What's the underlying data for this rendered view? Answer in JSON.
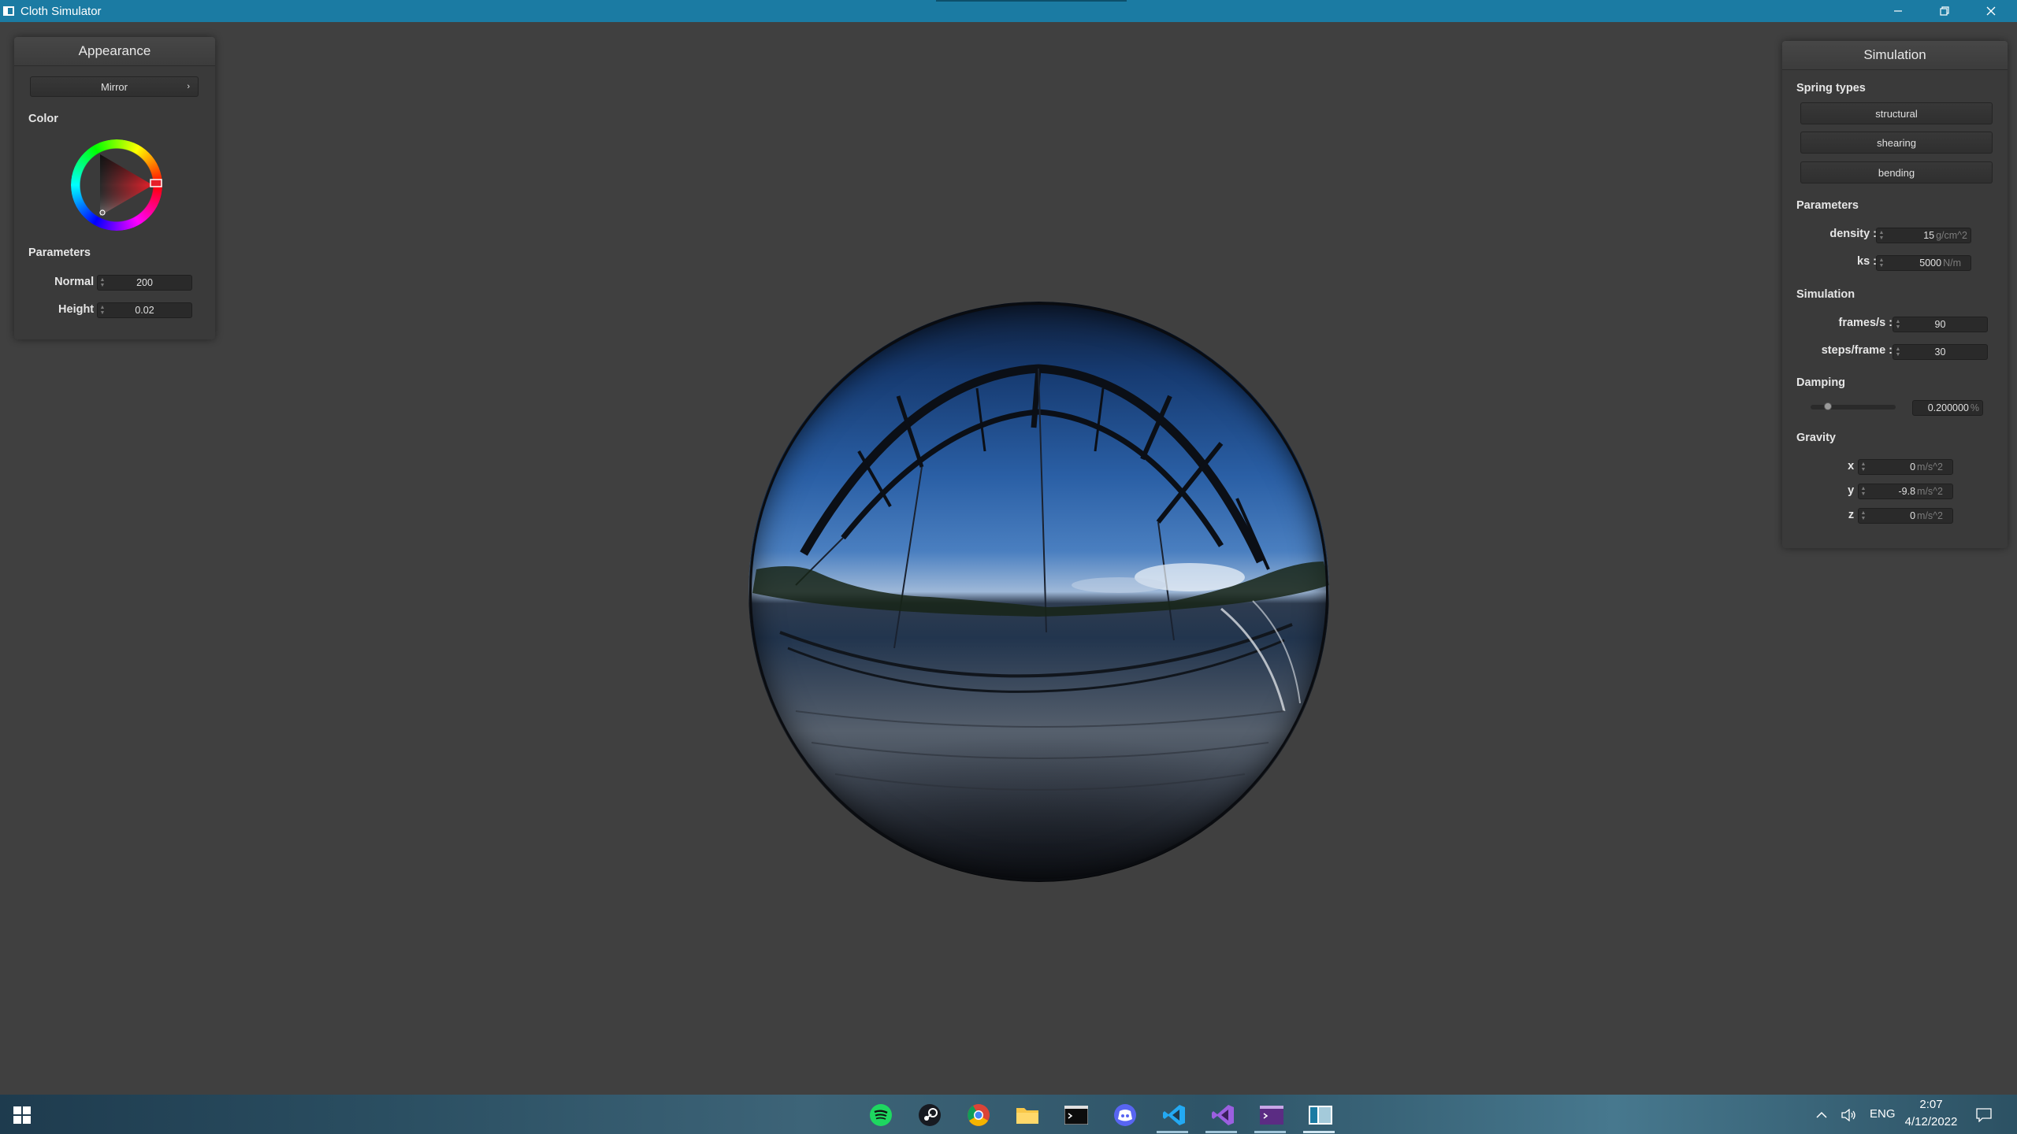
{
  "window": {
    "title": "Cloth Simulator"
  },
  "appearance_panel": {
    "header": "Appearance",
    "material_dropdown": "Mirror",
    "color_label": "Color",
    "parameters_label": "Parameters",
    "normal": {
      "label": "Normal :",
      "value": "200"
    },
    "height": {
      "label": "Height :",
      "value": "0.02"
    }
  },
  "simulation_panel": {
    "header": "Simulation",
    "spring_types_label": "Spring types",
    "spring_buttons": [
      "structural",
      "shearing",
      "bending"
    ],
    "parameters_label": "Parameters",
    "density": {
      "label": "density :",
      "value": "15",
      "unit": "g/cm^2"
    },
    "ks": {
      "label": "ks :",
      "value": "5000",
      "unit": "N/m"
    },
    "simulation_label": "Simulation",
    "frames": {
      "label": "frames/s :",
      "value": "90"
    },
    "steps": {
      "label": "steps/frame :",
      "value": "30"
    },
    "damping_label": "Damping",
    "damping": {
      "value": "0.200000",
      "unit": "%",
      "slider_fraction": 0.2
    },
    "gravity_label": "Gravity",
    "gravity": [
      {
        "label": "x :",
        "value": "0",
        "unit": "m/s^2"
      },
      {
        "label": "y :",
        "value": "-9.8",
        "unit": "m/s^2"
      },
      {
        "label": "z :",
        "value": "0",
        "unit": "m/s^2"
      }
    ]
  },
  "taskbar": {
    "apps": [
      "spotify-icon",
      "steam-icon",
      "chrome-icon",
      "file-explorer-icon",
      "terminal-icon",
      "discord-icon",
      "vscode-icon",
      "visual-studio-icon",
      "terminal-purple-icon",
      "cloth-simulator-icon"
    ],
    "language": "ENG",
    "time": "2:07",
    "date": "4/12/2022"
  },
  "colors": {
    "titlebar": "#1b7ba3",
    "background": "#404040",
    "panel": "#3a3a3a",
    "selected_color": "#e6202a"
  }
}
